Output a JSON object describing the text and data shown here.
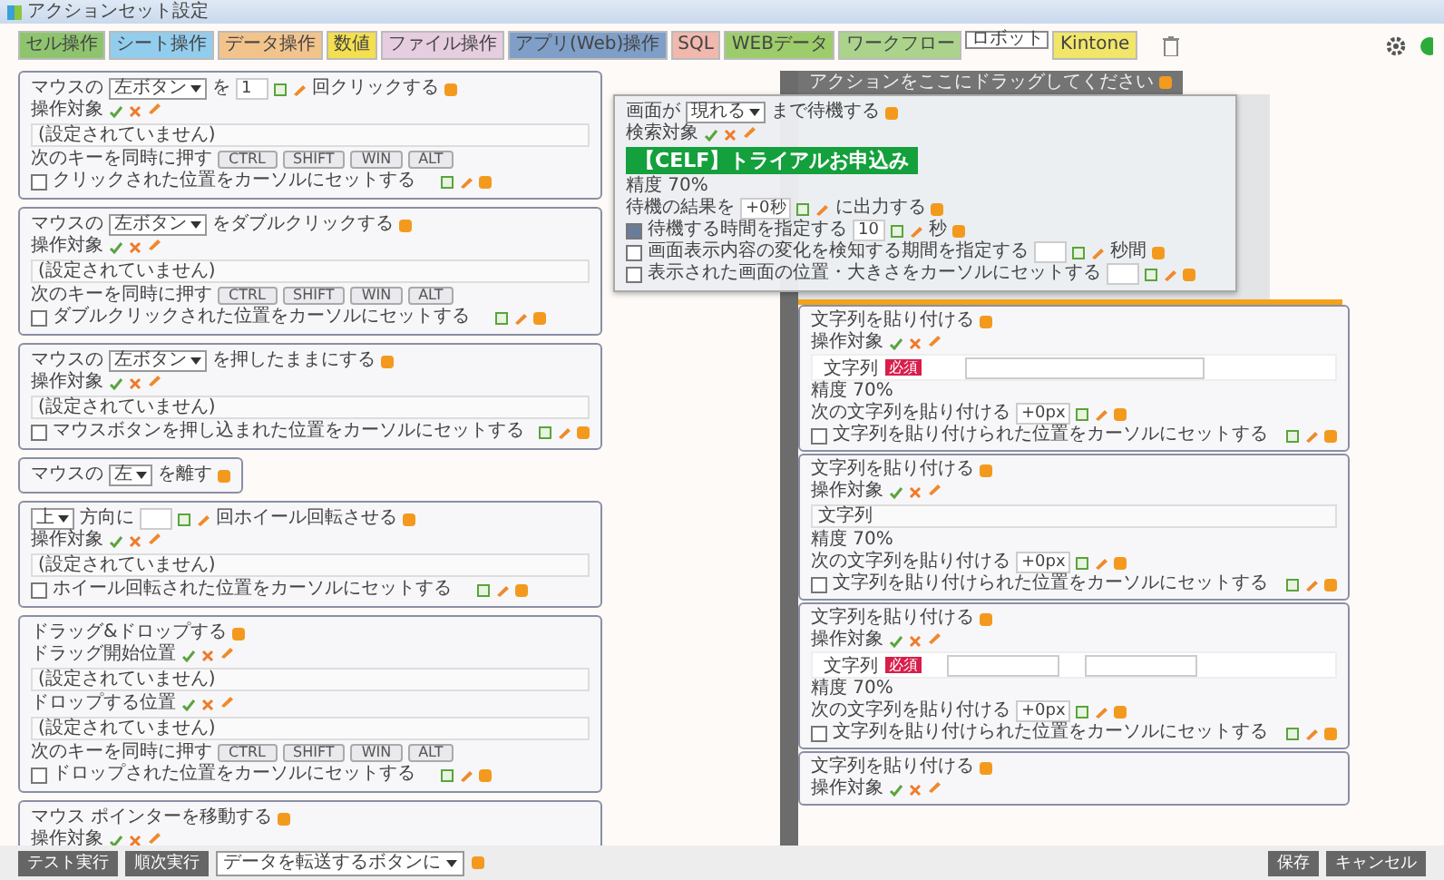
{
  "window": {
    "title": "アクションセット設定"
  },
  "tabs": [
    {
      "label": "セル操作",
      "color": "#8fc46f",
      "selected": false
    },
    {
      "label": "シート操作",
      "color": "#93cdee",
      "selected": false
    },
    {
      "label": "データ操作",
      "color": "#f2c48c",
      "selected": false
    },
    {
      "label": "数値",
      "color": "#f3df4f",
      "selected": false
    },
    {
      "label": "ファイル操作",
      "color": "#e6cde0",
      "selected": false
    },
    {
      "label": "アプリ(Web)操作",
      "color": "#7f9fc8",
      "selected": false
    },
    {
      "label": "SQL",
      "color": "#f1b8ae",
      "selected": false
    },
    {
      "label": "WEBデータ",
      "color": "#9dcc6b",
      "selected": false
    },
    {
      "label": "ワークフロー",
      "color": "#acd38c",
      "selected": false
    },
    {
      "label": "ロボット",
      "color": "#ffffff",
      "selected": true
    },
    {
      "label": "Kintone",
      "color": "#f1e66a",
      "selected": false
    }
  ],
  "left_cards": [
    {
      "rows": [
        {
          "kind": "title",
          "parts": [
            {
              "kind": "text",
              "text": "マウスの"
            },
            {
              "kind": "select",
              "value": "左ボタン"
            },
            {
              "kind": "text",
              "text": "を"
            },
            {
              "kind": "number",
              "value": "1"
            },
            {
              "kind": "text",
              "text": "回クリックする"
            }
          ]
        },
        {
          "kind": "target",
          "label": "操作対象"
        },
        {
          "kind": "field",
          "value": "(設定されていません)"
        },
        {
          "kind": "keys",
          "label": "次のキーを同時に押す",
          "keys": [
            "CTRL",
            "SHIFT",
            "WIN",
            "ALT"
          ]
        },
        {
          "kind": "checkbox",
          "label": "クリックされた位置をカーソルにセットする",
          "checked": false
        }
      ]
    },
    {
      "rows": [
        {
          "kind": "title",
          "parts": [
            {
              "kind": "text",
              "text": "マウスの"
            },
            {
              "kind": "select",
              "value": "左ボタン"
            },
            {
              "kind": "text",
              "text": "をダブルクリックする"
            }
          ]
        },
        {
          "kind": "target",
          "label": "操作対象"
        },
        {
          "kind": "field",
          "value": "(設定されていません)"
        },
        {
          "kind": "keys",
          "label": "次のキーを同時に押す",
          "keys": [
            "CTRL",
            "SHIFT",
            "WIN",
            "ALT"
          ]
        },
        {
          "kind": "checkbox",
          "label": "ダブルクリックされた位置をカーソルにセットする",
          "checked": false
        }
      ]
    },
    {
      "rows": [
        {
          "kind": "title",
          "parts": [
            {
              "kind": "text",
              "text": "マウスの"
            },
            {
              "kind": "select",
              "value": "左ボタン"
            },
            {
              "kind": "text",
              "text": "を押したままにする"
            }
          ]
        },
        {
          "kind": "target",
          "label": "操作対象"
        },
        {
          "kind": "field",
          "value": "(設定されていません)"
        },
        {
          "kind": "checkbox",
          "label": "マウスボタンを押し込まれた位置をカーソルにセットする",
          "checked": false
        }
      ]
    },
    {
      "rows": [
        {
          "kind": "title",
          "parts": [
            {
              "kind": "text",
              "text": "マウスの"
            },
            {
              "kind": "select",
              "value": "左"
            },
            {
              "kind": "text",
              "text": "を離す"
            }
          ]
        }
      ]
    },
    {
      "rows": [
        {
          "kind": "title",
          "parts": [
            {
              "kind": "select",
              "value": "上"
            },
            {
              "kind": "text",
              "text": "方向に"
            },
            {
              "kind": "number"
            },
            {
              "kind": "text",
              "text": "回ホイール回転させる"
            }
          ]
        },
        {
          "kind": "target",
          "label": "操作対象"
        },
        {
          "kind": "field",
          "value": "(設定されていません)"
        },
        {
          "kind": "checkbox",
          "label": "ホイール回転された位置をカーソルにセットする",
          "checked": false
        }
      ]
    },
    {
      "rows": [
        {
          "kind": "title",
          "parts": [
            {
              "kind": "text",
              "text": "ドラッグ&ドロップする"
            }
          ]
        },
        {
          "kind": "target",
          "label": "ドラッグ開始位置"
        },
        {
          "kind": "field",
          "value": "(設定されていません)"
        },
        {
          "kind": "target",
          "label": "ドロップする位置"
        },
        {
          "kind": "field",
          "value": "(設定されていません)"
        },
        {
          "kind": "keys",
          "label": "次のキーを同時に押す",
          "keys": [
            "CTRL",
            "SHIFT",
            "WIN",
            "ALT"
          ]
        },
        {
          "kind": "checkbox",
          "label": "ドロップされた位置をカーソルにセットする",
          "checked": false
        }
      ]
    },
    {
      "rows": [
        {
          "kind": "title",
          "parts": [
            {
              "kind": "text",
              "text": "マウス ポインターを移動する"
            }
          ]
        },
        {
          "kind": "target",
          "label": "操作対象"
        }
      ]
    }
  ],
  "popup": {
    "rows": [
      {
        "kind": "title",
        "parts": [
          {
            "kind": "text",
            "text": "画面が"
          },
          {
            "kind": "select",
            "value": "現れる"
          },
          {
            "kind": "text",
            "text": "まで待機する"
          }
        ]
      },
      {
        "kind": "target",
        "label": "検索対象"
      },
      {
        "kind": "banner",
        "text": "【CELF】トライアルお申込み"
      },
      {
        "kind": "text",
        "text": "精度 70%"
      },
      {
        "kind": "line",
        "parts": [
          {
            "kind": "text",
            "text": "待機の結果を"
          },
          {
            "kind": "number",
            "value": "+0秒"
          },
          {
            "kind": "text",
            "text": "に出力する"
          }
        ]
      },
      {
        "kind": "checkline",
        "checked": true,
        "parts": [
          {
            "kind": "text",
            "text": "待機する時間を指定する"
          },
          {
            "kind": "number",
            "value": "10"
          },
          {
            "kind": "text",
            "text": "秒"
          }
        ]
      },
      {
        "kind": "checkline",
        "checked": false,
        "parts": [
          {
            "kind": "text",
            "text": "画面表示内容の変化を検知する期間を指定する"
          },
          {
            "kind": "number"
          },
          {
            "kind": "text",
            "text": "秒間"
          }
        ]
      },
      {
        "kind": "checkline",
        "checked": false,
        "parts": [
          {
            "kind": "text",
            "text": "表示された画面の位置・大きさをカーソルにセットする"
          },
          {
            "kind": "number"
          }
        ]
      }
    ]
  },
  "right_panel": {
    "header": "アクションをここにドラッグしてください",
    "cards": [
      {
        "rows": [
          {
            "kind": "title",
            "parts": [
              {
                "kind": "text",
                "text": "文字列を貼り付ける"
              }
            ]
          },
          {
            "kind": "target",
            "label": "操作対象"
          },
          {
            "kind": "labelinput",
            "label": "文字列",
            "badge": "必須",
            "inputs": [
              {
                "kind": "wide"
              }
            ]
          },
          {
            "kind": "text",
            "text": "精度 70%"
          },
          {
            "kind": "line",
            "parts": [
              {
                "kind": "text",
                "text": "次の文字列を貼り付ける"
              },
              {
                "kind": "number",
                "value": "+0px"
              }
            ]
          },
          {
            "kind": "checkbox",
            "label": "文字列を貼り付けられた位置をカーソルにセットする",
            "checked": false
          }
        ]
      },
      {
        "rows": [
          {
            "kind": "title",
            "parts": [
              {
                "kind": "text",
                "text": "文字列を貼り付ける"
              }
            ]
          },
          {
            "kind": "target",
            "label": "操作対象"
          },
          {
            "kind": "field",
            "value": "文字列"
          },
          {
            "kind": "text",
            "text": "精度 70%"
          },
          {
            "kind": "line",
            "parts": [
              {
                "kind": "text",
                "text": "次の文字列を貼り付ける"
              },
              {
                "kind": "number",
                "value": "+0px"
              }
            ]
          },
          {
            "kind": "checkbox",
            "label": "文字列を貼り付けられた位置をカーソルにセットする",
            "checked": false
          }
        ]
      },
      {
        "rows": [
          {
            "kind": "title",
            "parts": [
              {
                "kind": "text",
                "text": "文字列を貼り付ける"
              }
            ]
          },
          {
            "kind": "target",
            "label": "操作対象"
          },
          {
            "kind": "labelinput",
            "label": "文字列",
            "badge": "必須",
            "inputs": [
              {
                "kind": "short"
              },
              {
                "kind": "short"
              }
            ]
          },
          {
            "kind": "text",
            "text": "精度 70%"
          },
          {
            "kind": "line",
            "parts": [
              {
                "kind": "text",
                "text": "次の文字列を貼り付ける"
              },
              {
                "kind": "number",
                "value": "+0px"
              }
            ]
          },
          {
            "kind": "checkbox",
            "label": "文字列を貼り付けられた位置をカーソルにセットする",
            "checked": false
          }
        ]
      },
      {
        "rows": [
          {
            "kind": "title",
            "parts": [
              {
                "kind": "text",
                "text": "文字列を貼り付ける"
              }
            ]
          },
          {
            "kind": "target",
            "label": "操作対象"
          }
        ]
      }
    ]
  },
  "bottom_bar": {
    "buttons": [
      "テスト実行",
      "順次実行"
    ],
    "select": "データを転送するボタンに",
    "actions": [
      "保存",
      "キャンセル"
    ]
  }
}
